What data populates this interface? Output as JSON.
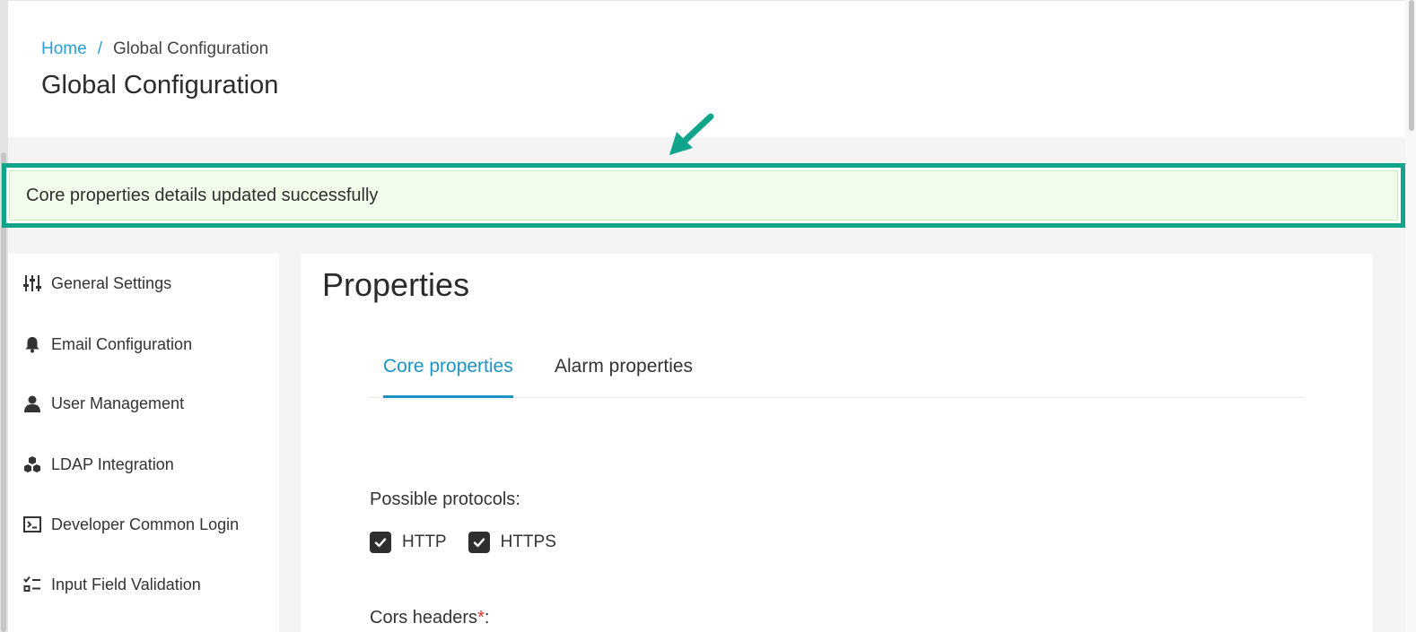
{
  "breadcrumb": {
    "home": "Home",
    "separator": "/",
    "current": "Global Configuration"
  },
  "page_title": "Global Configuration",
  "alert": {
    "message": "Core properties details updated successfully",
    "highlight_color": "#10a58a"
  },
  "sidebar": {
    "items": [
      {
        "label": "General Settings",
        "icon": "sliders-icon"
      },
      {
        "label": "Email Configuration",
        "icon": "bell-icon"
      },
      {
        "label": "User Management",
        "icon": "user-icon"
      },
      {
        "label": "LDAP Integration",
        "icon": "cubes-icon"
      },
      {
        "label": "Developer Common Login",
        "icon": "terminal-icon"
      },
      {
        "label": "Input Field Validation",
        "icon": "checklist-icon"
      }
    ]
  },
  "main": {
    "title": "Properties",
    "tabs": [
      {
        "label": "Core properties",
        "active": true
      },
      {
        "label": "Alarm properties",
        "active": false
      }
    ],
    "protocols_label": "Possible protocols",
    "protocols_colon": ":",
    "protocols": [
      {
        "label": "HTTP",
        "checked": true
      },
      {
        "label": "HTTPS",
        "checked": true
      }
    ],
    "cors_label": "Cors headers",
    "cors_required": "*",
    "cors_colon": ":"
  },
  "colors": {
    "accent": "#1b94c6",
    "link": "#2a9fd8",
    "alert_bg": "#f1fcea",
    "required": "#e0352b"
  }
}
